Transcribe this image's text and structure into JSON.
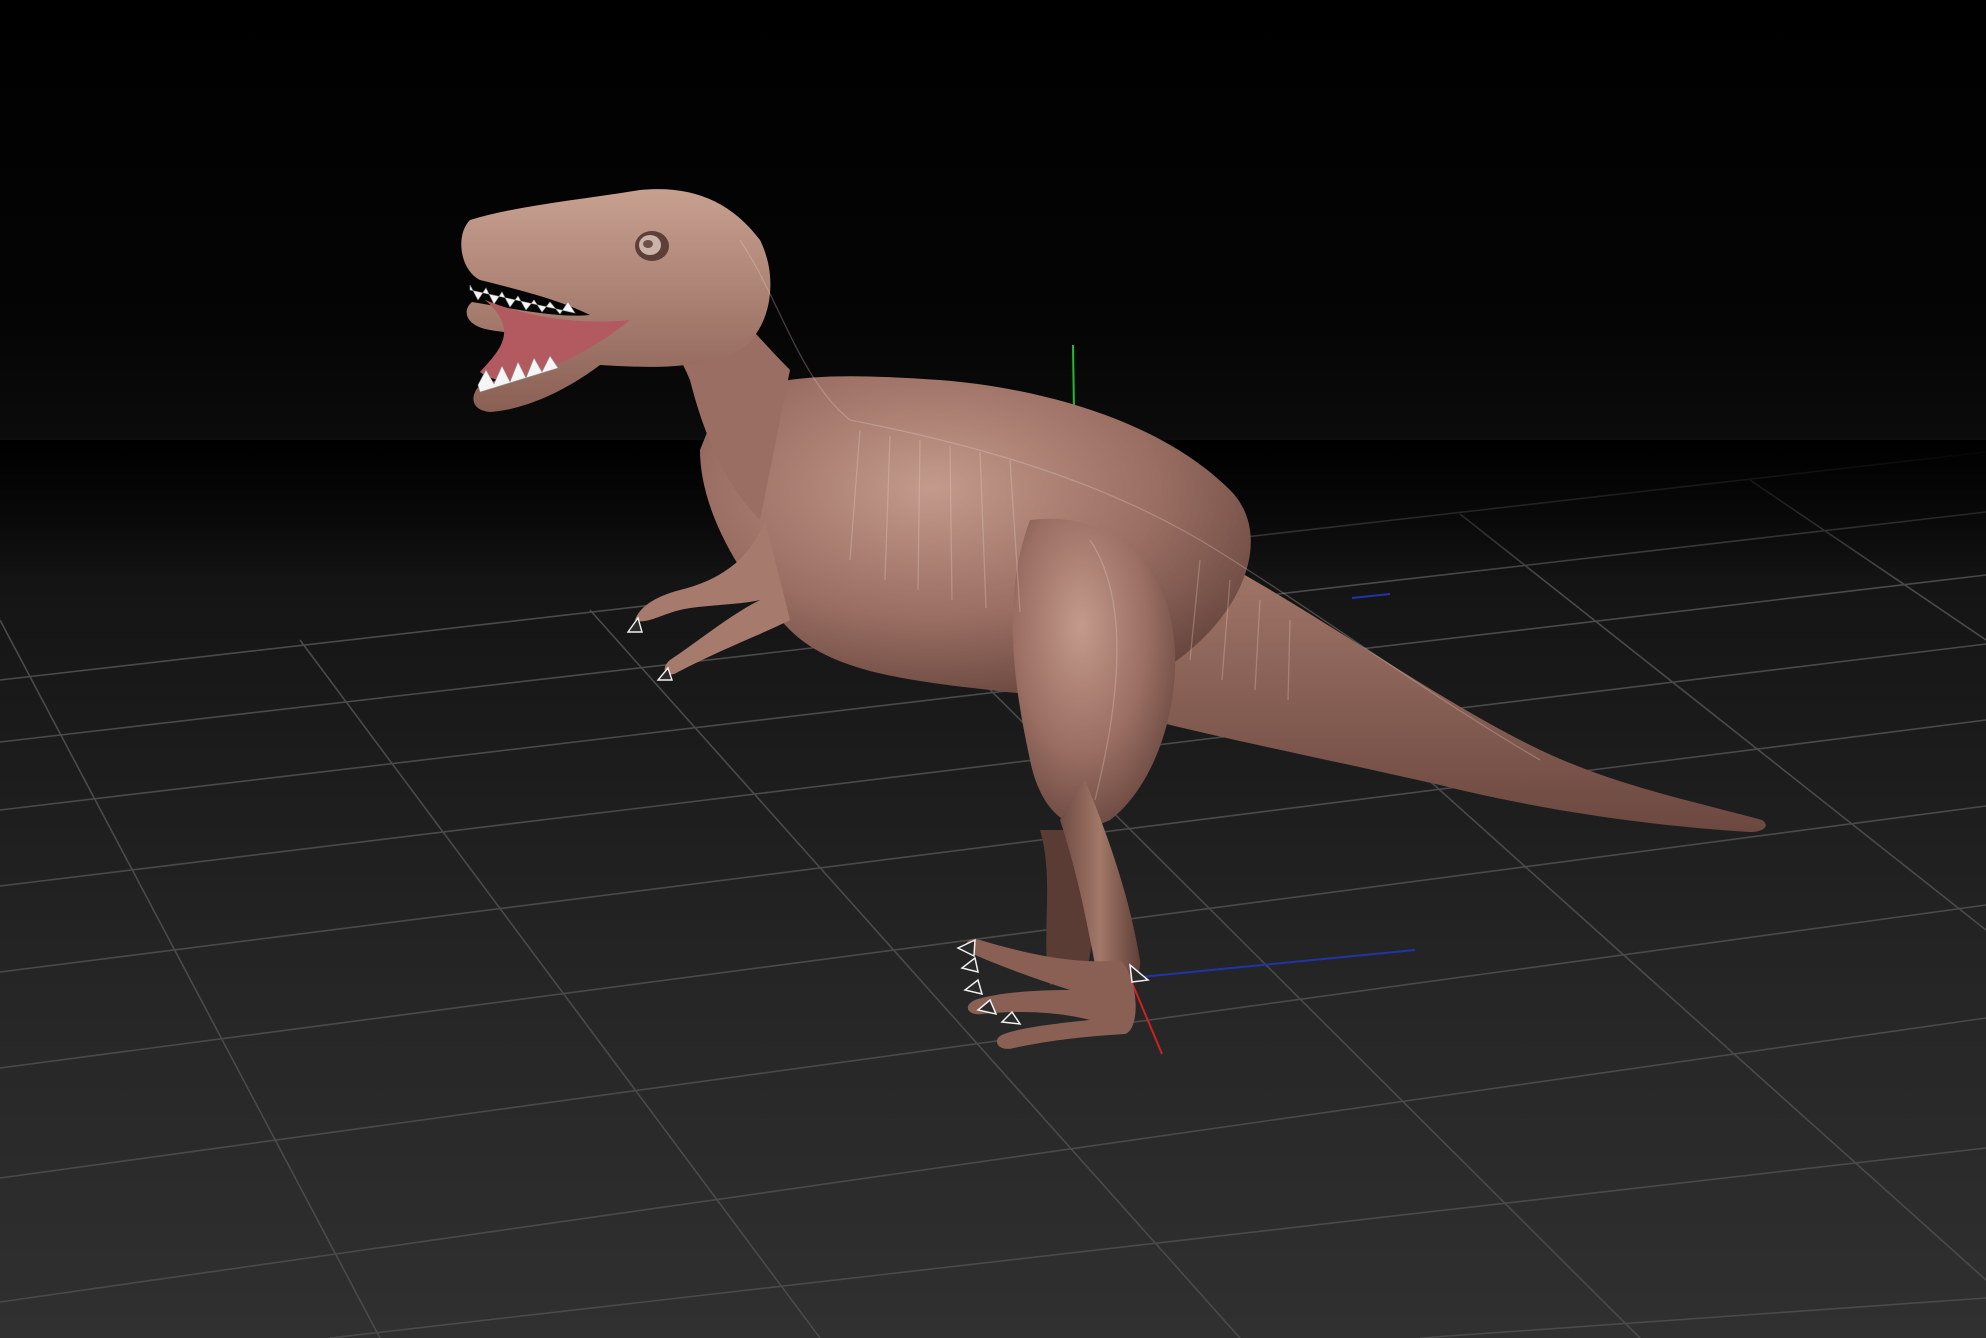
{
  "viewport": {
    "object": "t-rex sculpt",
    "show_floor_grid": true,
    "show_gizmo": true
  },
  "colors": {
    "background_top": "#000000",
    "background_bottom": "#303030",
    "grid_line": "#4a4a4a",
    "model_skin": "#9a6e62",
    "model_shadow": "#5e3f38",
    "model_highlight": "#c39a8c",
    "mouth_inside": "#b25a60",
    "claw": "#f0f0f0",
    "axis_x": "#cc2222",
    "axis_y": "#22bb33",
    "axis_z": "#2233aa"
  }
}
